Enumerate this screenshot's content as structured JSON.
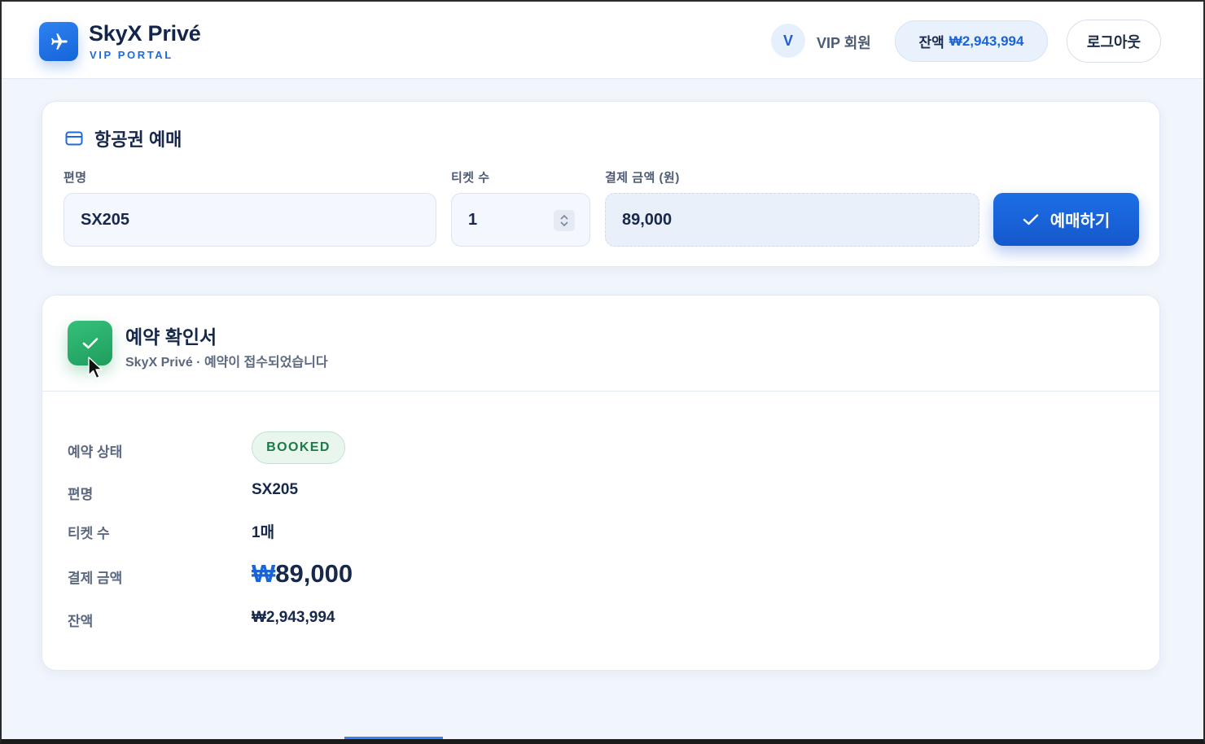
{
  "header": {
    "brand_name": "SkyX Privé",
    "brand_sub": "VIP PORTAL",
    "avatar_initial": "V",
    "member_label": "VIP 회원",
    "balance_label": "잔액",
    "balance_value": "₩2,943,994",
    "logout_label": "로그아웃",
    "logo_icon": "airplane-icon"
  },
  "booking": {
    "title": "항공권 예매",
    "title_icon": "card-icon",
    "flight_label": "편명",
    "flight_value": "SX205",
    "tickets_label": "티켓 수",
    "tickets_value": "1",
    "amount_label": "결제 금액 (원)",
    "amount_value": "89,000",
    "book_label": "예매하기"
  },
  "confirmation": {
    "title": "예약 확인서",
    "subtitle": "SkyX Privé · 예약이 접수되었습니다",
    "rows": {
      "status_label": "예약 상태",
      "status_value": "BOOKED",
      "flight_label": "편명",
      "flight_value": "SX205",
      "tickets_label": "티켓 수",
      "tickets_value": "1매",
      "amount_label": "결제 금액",
      "amount_currency": "₩",
      "amount_value": "89,000",
      "balance_label": "잔액",
      "balance_value": "₩2,943,994"
    }
  },
  "colors": {
    "accent": "#1a64d6",
    "success": "#1f9d5e",
    "background": "#f1f5fc"
  }
}
